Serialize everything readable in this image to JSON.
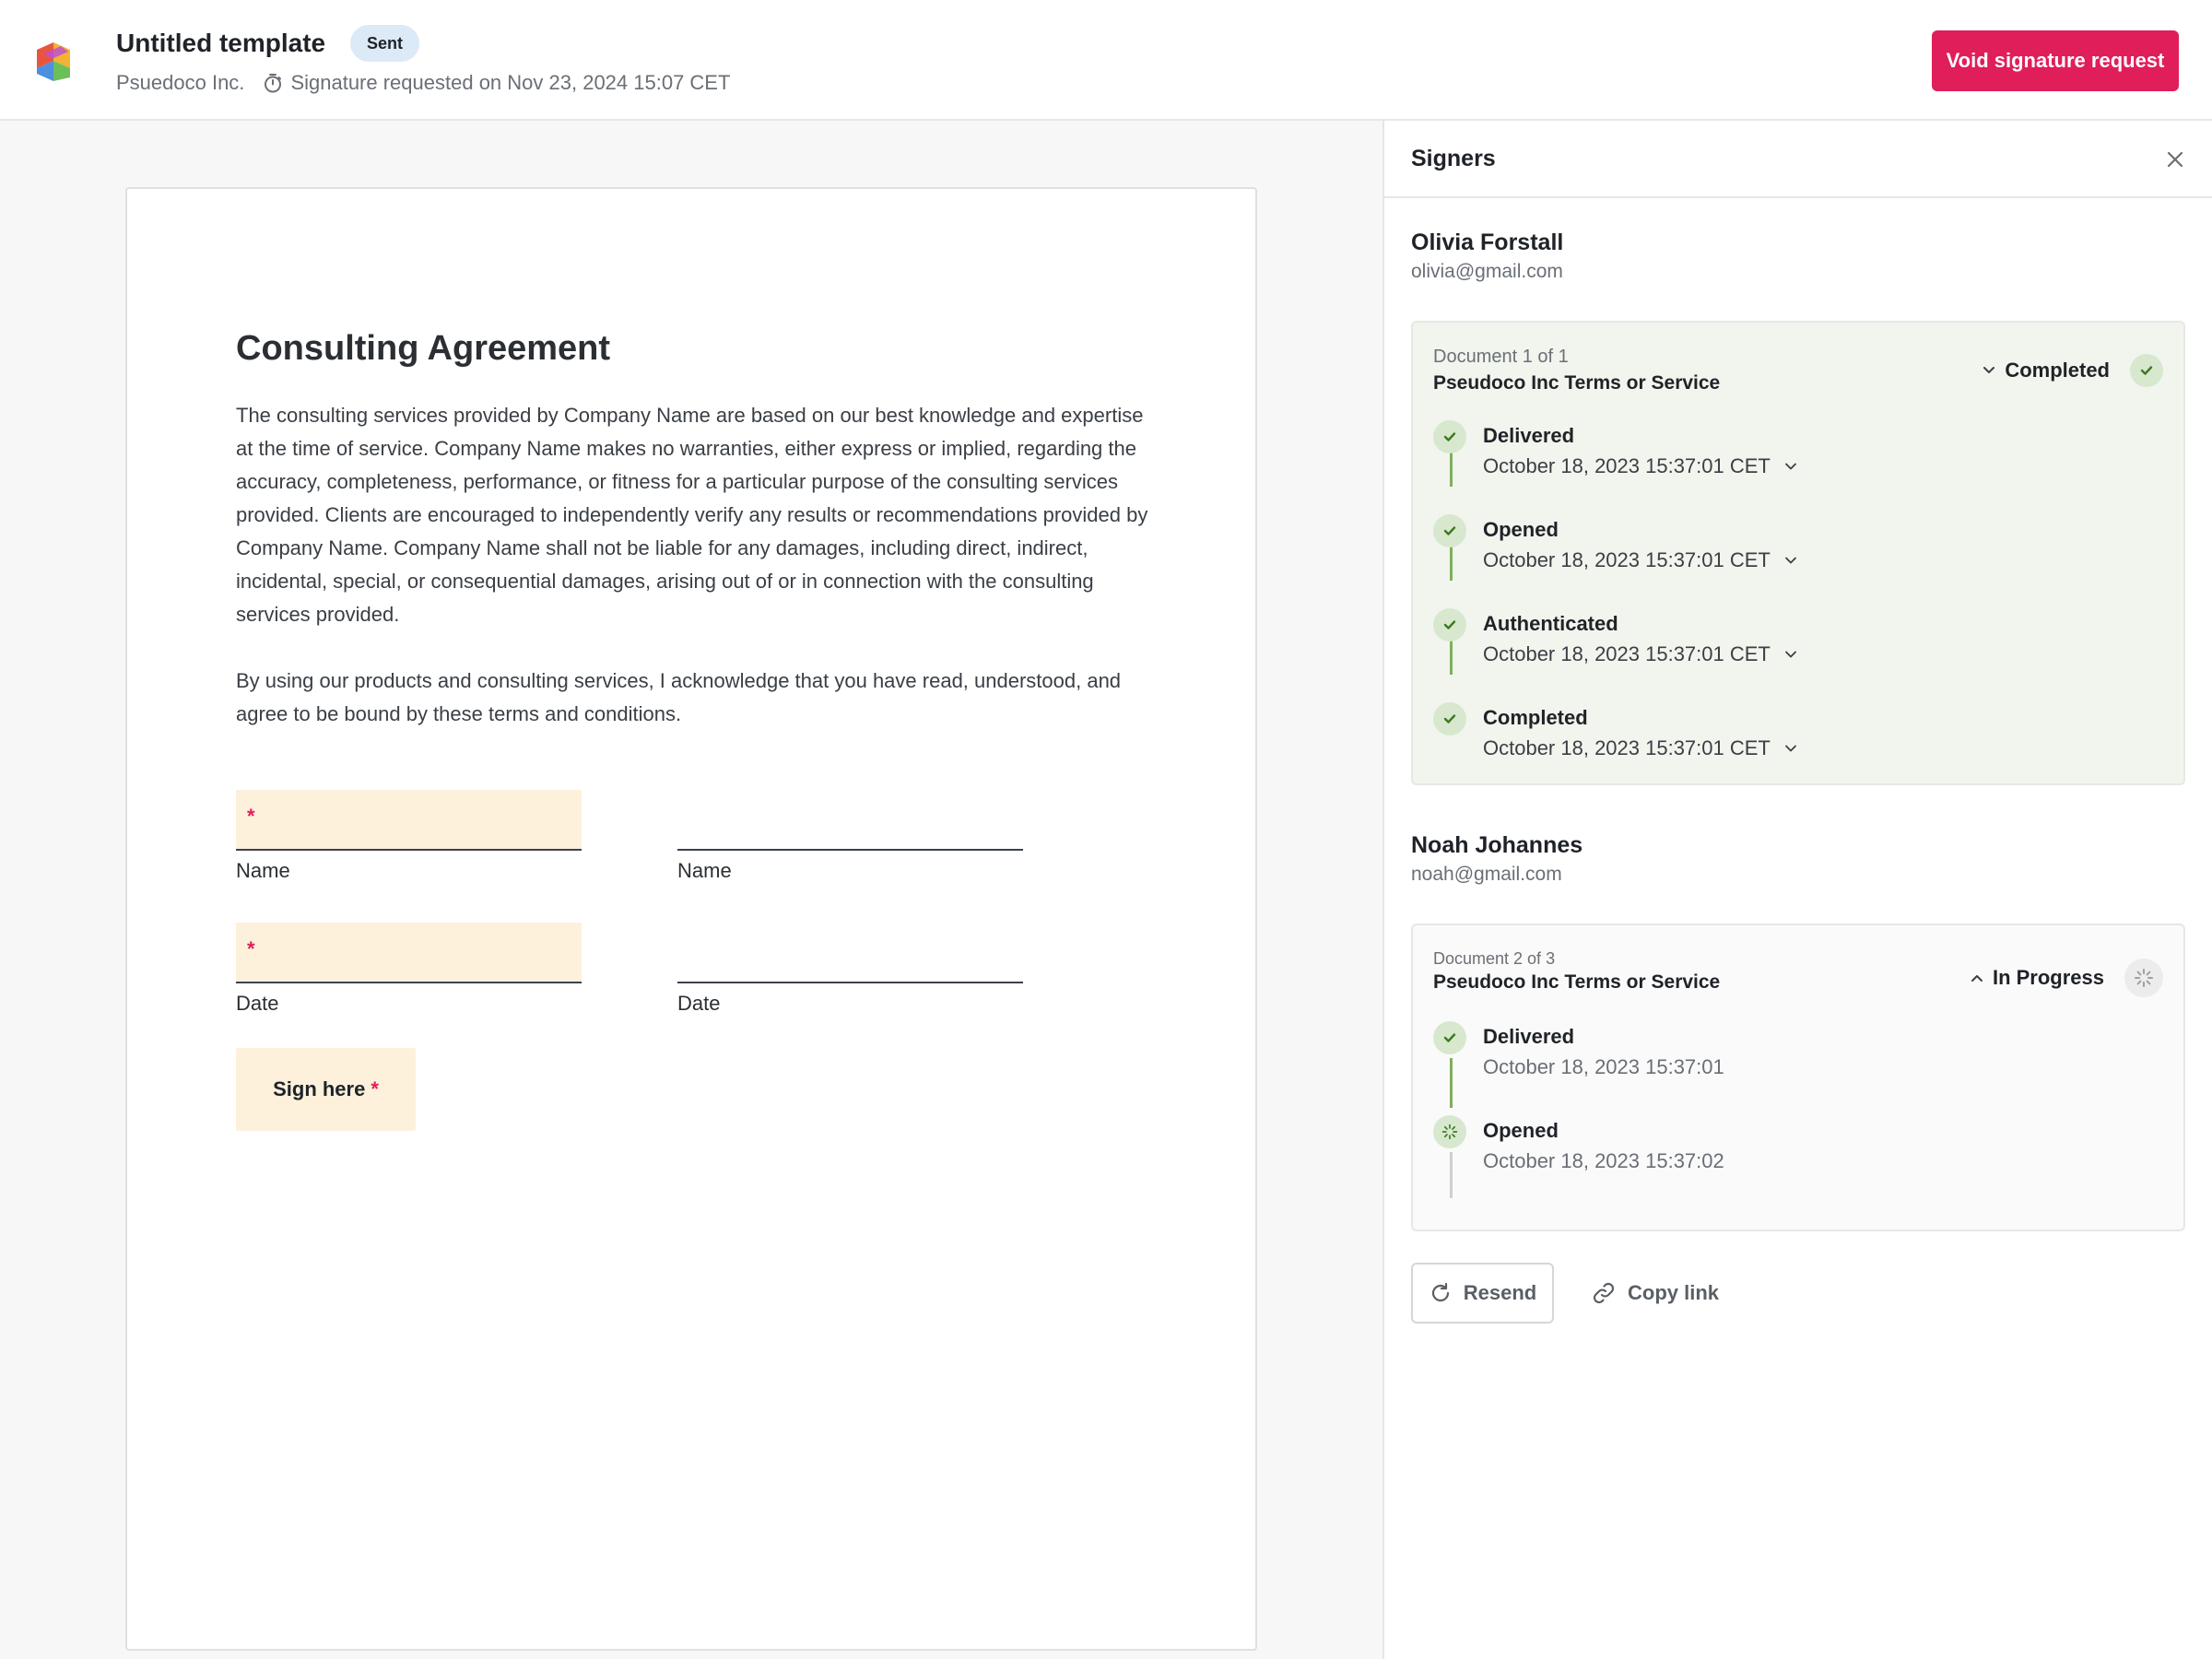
{
  "header": {
    "title": "Untitled template",
    "badge": "Sent",
    "company": "Psuedoco Inc.",
    "requested": "Signature requested on Nov 23, 2024 15:07 CET",
    "void_label": "Void signature request",
    "accent_color": "#e01e5a",
    "icons": [
      "app-logo-icon",
      "timer-icon"
    ]
  },
  "document": {
    "title": "Consulting Agreement",
    "paragraph1": "The consulting services provided by Company Name are based on our best knowledge and expertise at the time of service. Company Name makes no warranties, either express or implied, regarding the accuracy, completeness, performance, or fitness for a particular purpose of the consulting services provided. Clients are encouraged to independently verify any results or recommendations provided by Company Name. Company Name shall not be liable for any damages, including direct, indirect, incidental, special, or consequential damages, arising out of or in connection with the consulting services provided.",
    "paragraph2": "By using our products and consulting services, I acknowledge that you have read, understood, and agree to be bound by these terms and conditions.",
    "fields": {
      "name_label_1": "Name",
      "name_label_2": "Name",
      "date_label_1": "Date",
      "date_label_2": "Date",
      "required_mark": "*"
    },
    "sign_label": "Sign here",
    "field_color": "#fdf1dc"
  },
  "panel": {
    "title": "Signers",
    "signers": [
      {
        "name": "Olivia Forstall",
        "email": "olivia@gmail.com",
        "doc_index": "Document 1 of 1",
        "doc_title": "Pseudoco Inc Terms or Service",
        "status": "Completed",
        "events": [
          {
            "label": "Delivered",
            "time": "October 18, 2023 15:37:01 CET"
          },
          {
            "label": "Opened",
            "time": "October 18, 2023 15:37:01 CET"
          },
          {
            "label": "Authenticated",
            "time": "October 18, 2023 15:37:01 CET"
          },
          {
            "label": "Completed",
            "time": "October 18, 2023 15:37:01 CET"
          }
        ]
      },
      {
        "name": "Noah Johannes",
        "email": "noah@gmail.com",
        "doc_index": "Document 2 of 3",
        "doc_title": "Pseudoco Inc Terms or Service",
        "status": "In Progress",
        "events": [
          {
            "label": "Delivered",
            "time": "October 18, 2023 15:37:01"
          },
          {
            "label": "Opened",
            "time": "October 18, 2023 15:37:02"
          }
        ]
      }
    ],
    "resend_label": "Resend",
    "copy_label": "Copy link",
    "success_color": "#7fae5c"
  }
}
